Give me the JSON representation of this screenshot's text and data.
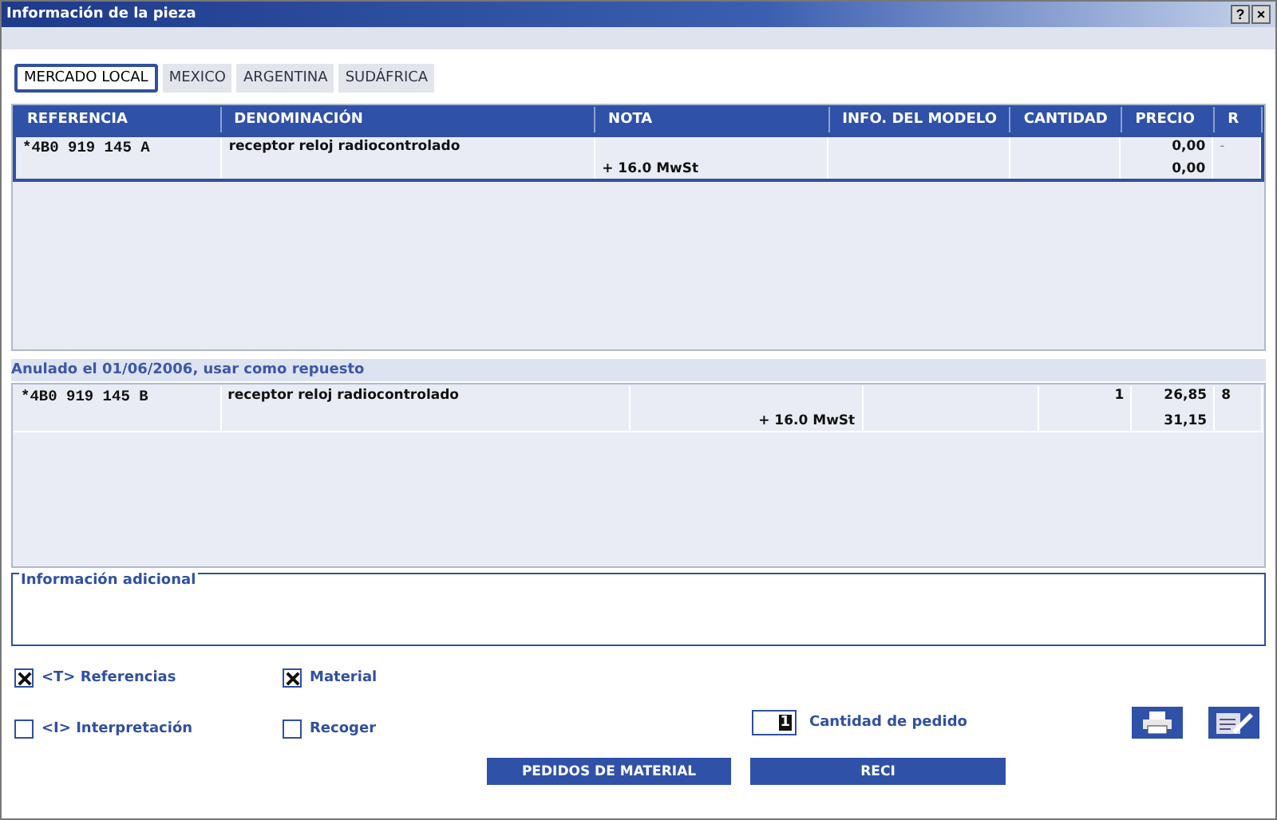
{
  "window": {
    "title": "Información de la pieza",
    "buttons": [
      "?",
      "×"
    ]
  },
  "tabs": [
    {
      "label": "MERCADO LOCAL",
      "selected": true
    },
    {
      "label": "MEXICO",
      "selected": false
    },
    {
      "label": "ARGENTINA",
      "selected": false
    },
    {
      "label": "SUDÁFRICA",
      "selected": false
    }
  ],
  "table": {
    "columns": [
      "REFERENCIA",
      "DENOMINACIÓN",
      "NOTA",
      "INFO. DEL MODELO",
      "CANTIDAD",
      "PRECIO",
      "R"
    ],
    "rows": [
      {
        "referencia": "*4B0 919 145 A",
        "denominacion": "receptor reloj radiocontrolado",
        "nota": "+ 16.0 MwSt",
        "info": "",
        "cantidad": "",
        "precio": "0,00",
        "precio_iva": "0,00",
        "r": "-",
        "selected": true
      }
    ]
  },
  "replacement": {
    "label": "Anulado el 01/06/2006, usar como repuesto",
    "rows": [
      {
        "referencia": "*4B0 919 145 B",
        "denominacion": "receptor reloj radiocontrolado",
        "nota": "+ 16.0 MwSt",
        "info": "",
        "cantidad": "1",
        "precio": "26,85",
        "precio_iva": "31,15",
        "r": "8",
        "selected": false
      }
    ]
  },
  "additional_info": {
    "label": "Información adicional"
  },
  "checkboxes": [
    {
      "label": "<T> Referencias",
      "checked": true
    },
    {
      "label": "Material",
      "checked": true
    },
    {
      "label": "<I> Interpretación",
      "checked": false
    },
    {
      "label": "Recoger",
      "checked": false
    }
  ],
  "order_quantity": {
    "value": "1",
    "label": "Cantidad de pedido"
  },
  "buttons": [
    "PEDIDOS DE MATERIAL",
    "RECI"
  ]
}
